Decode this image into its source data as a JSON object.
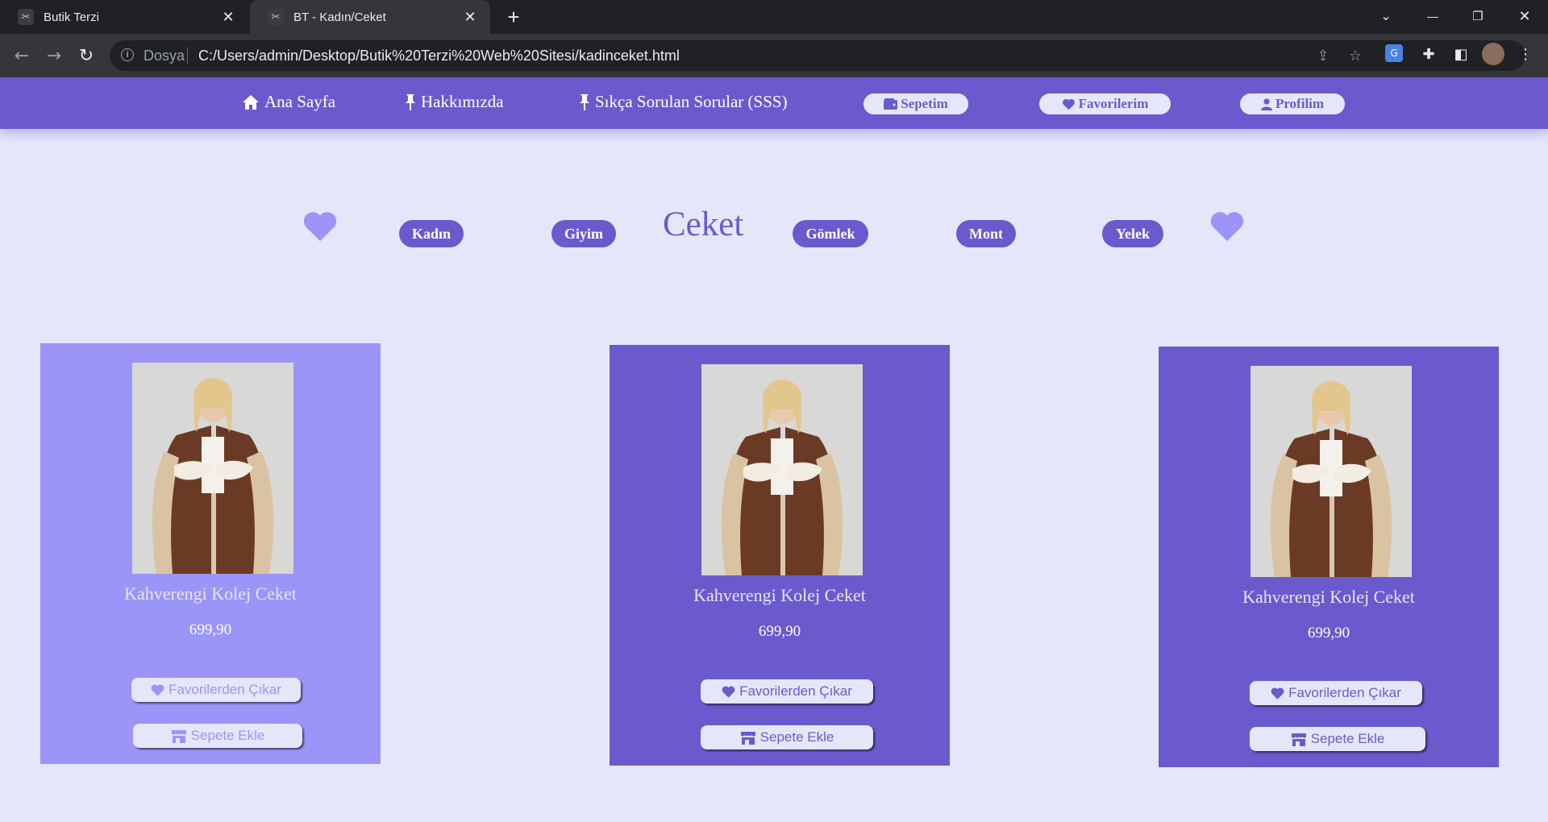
{
  "browser": {
    "tabs": [
      {
        "title": "Butik Terzi",
        "active": false
      },
      {
        "title": "BT - Kadın/Ceket",
        "active": true
      }
    ],
    "new_tab": "+",
    "window_controls": {
      "tab_search": "⌄",
      "minimize": "—",
      "restore": "❐",
      "close": "✕"
    },
    "address": {
      "security_label": "Dosya",
      "url": "C:/Users/admin/Desktop/Butik%20Terzi%20Web%20Sitesi/kadinceket.html"
    },
    "icons": [
      "back-icon",
      "forward-icon",
      "reload-icon",
      "share-icon",
      "star-icon",
      "translate-icon",
      "extensions-icon",
      "side-panel-icon",
      "profile-avatar",
      "menu-icon"
    ]
  },
  "nav": {
    "links": [
      {
        "icon": "home-icon",
        "label": "Ana Sayfa"
      },
      {
        "icon": "pin-icon",
        "label": "Hakkımızda"
      },
      {
        "icon": "pin-icon",
        "label": "Sıkça Sorulan Sorular (SSS)"
      }
    ],
    "pills": [
      {
        "icon": "wallet-icon",
        "label": "Sepetim"
      },
      {
        "icon": "heart-icon",
        "label": "Favorilerim"
      },
      {
        "icon": "user-icon",
        "label": "Profilim"
      }
    ]
  },
  "categories": {
    "title": "Ceket",
    "items": [
      "Kadın",
      "Giyim",
      "Gömlek",
      "Mont",
      "Yelek"
    ]
  },
  "products": [
    {
      "name": "Kahverengi Kolej Ceket",
      "price": "699,90",
      "fav_button": "Favorilerden Çıkar",
      "cart_button": "Sepete Ekle",
      "style": "light"
    },
    {
      "name": "Kahverengi Kolej Ceket",
      "price": "699,90",
      "fav_button": "Favorilerden Çıkar",
      "cart_button": "Sepete Ekle",
      "style": "dark"
    },
    {
      "name": "Kahverengi Kolej Ceket",
      "price": "699,90",
      "fav_button": "Favorilerden Çıkar",
      "cart_button": "Sepete Ekle",
      "style": "dark"
    }
  ],
  "colors": {
    "accent": "#6a5acd",
    "accent_light": "#9b95f7",
    "background": "#e6e6fa"
  }
}
